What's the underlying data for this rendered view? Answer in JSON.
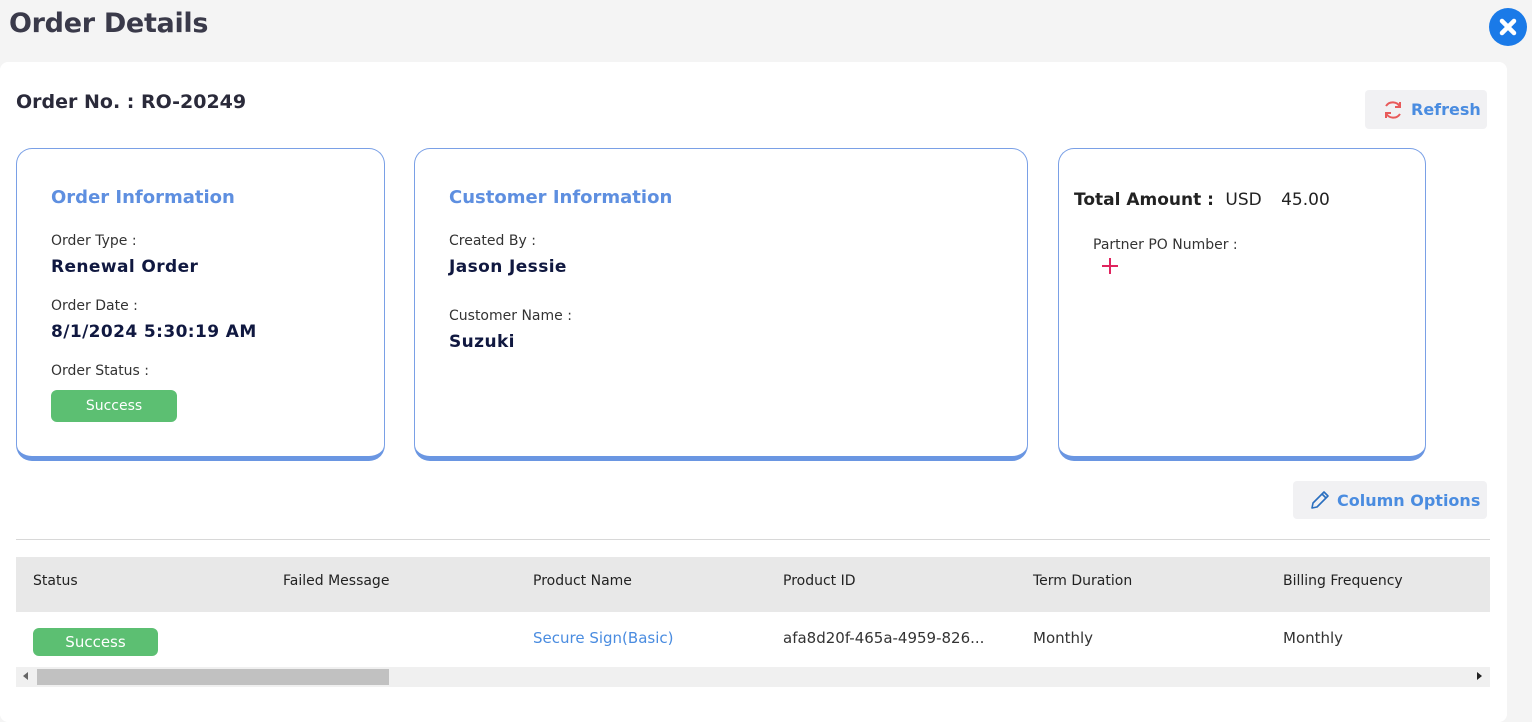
{
  "header": {
    "title": "Order Details"
  },
  "order": {
    "number_label": "Order No. : RO-20249"
  },
  "toolbar": {
    "refresh_label": "Refresh",
    "column_options_label": "Column Options"
  },
  "order_info": {
    "title": "Order Information",
    "type_label": "Order Type :",
    "type_value": "Renewal Order",
    "date_label": "Order Date :",
    "date_value": "8/1/2024 5:30:19 AM",
    "status_label": "Order Status :",
    "status_value": "Success"
  },
  "customer_info": {
    "title": "Customer Information",
    "created_by_label": "Created By :",
    "created_by_value": "Jason Jessie",
    "customer_name_label": "Customer Name :",
    "customer_name_value": "Suzuki"
  },
  "totals": {
    "total_label": "Total Amount :",
    "currency": "USD",
    "amount": "45.00",
    "partner_po_label": "Partner PO Number :"
  },
  "table": {
    "columns": [
      "Status",
      "Failed Message",
      "Product Name",
      "Product ID",
      "Term Duration",
      "Billing Frequency"
    ],
    "rows": [
      {
        "status": "Success",
        "failed_message": "",
        "product_name": "Secure Sign(Basic)",
        "product_id": "afa8d20f-465a-4959-826...",
        "term_duration": "Monthly",
        "billing_frequency": "Monthly"
      }
    ]
  },
  "colors": {
    "accent": "#5e8fe0",
    "success": "#5cbf72",
    "close_button": "#1a7ae8",
    "add_icon": "#e0245e"
  },
  "icons": {
    "close": "close-icon",
    "refresh": "refresh-icon",
    "column_options": "pencil-icon",
    "add": "plus-icon"
  }
}
